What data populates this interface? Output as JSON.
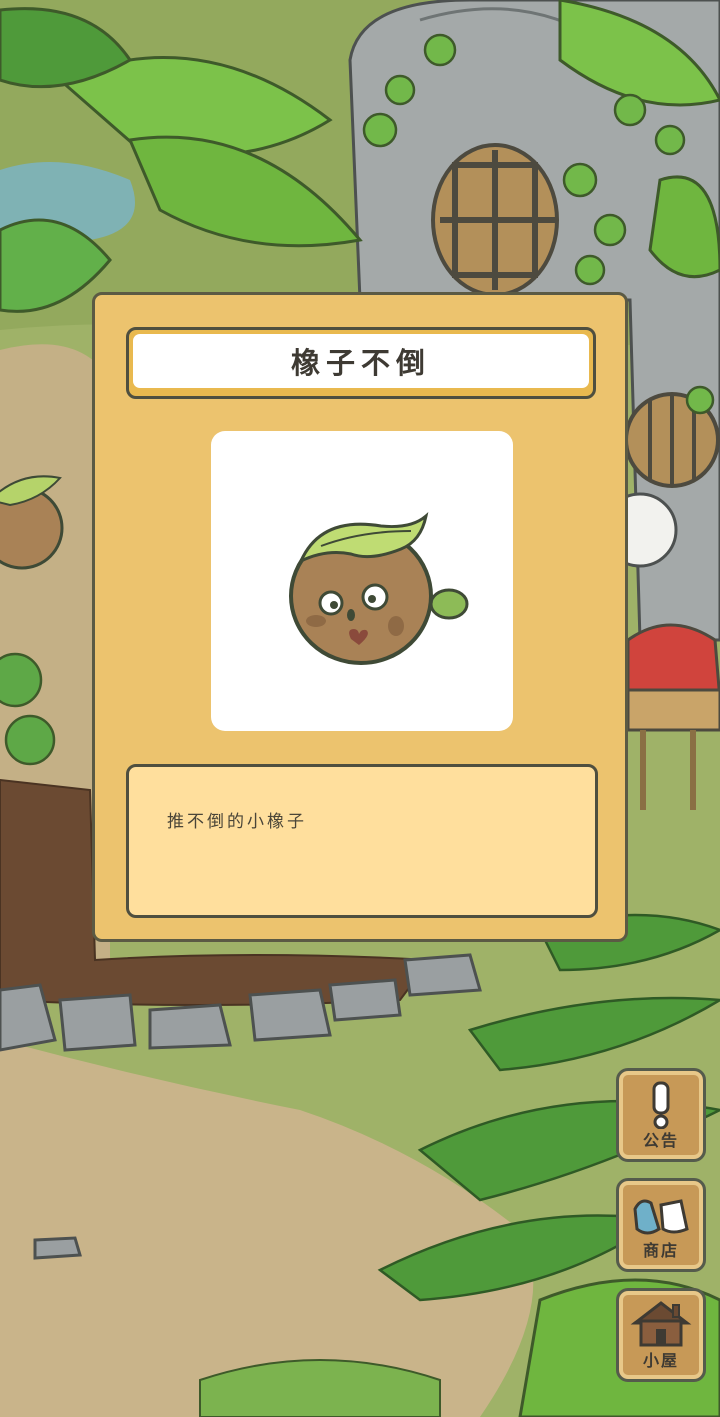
{
  "item": {
    "name": "橡子不倒",
    "description": "推不倒的小橡子",
    "image_icon": "acorn-tumbler-icon"
  },
  "side_menu": [
    {
      "label": "公告",
      "icon": "exclamation-icon"
    },
    {
      "label": "商店",
      "icon": "shop-bags-icon"
    },
    {
      "label": "小屋",
      "icon": "house-icon"
    }
  ],
  "colors": {
    "card_bg": "#ecc36e",
    "desc_bg": "#ffdf9d",
    "border": "#4f4f3f",
    "button_wood": "#c79957"
  }
}
